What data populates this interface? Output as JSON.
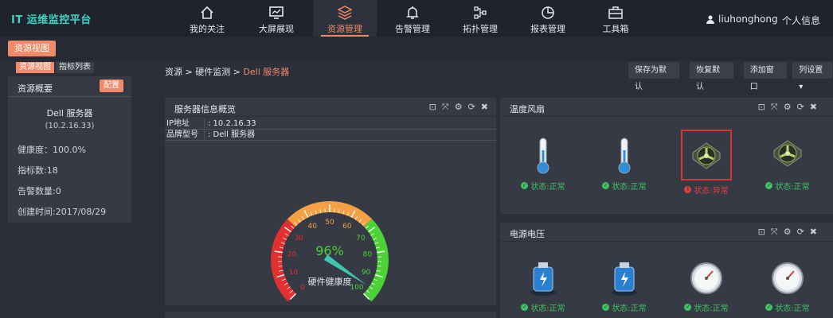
{
  "app": {
    "logo": "IT 运维监控平台"
  },
  "nav": [
    {
      "label": "我的关注",
      "icon": "home-icon"
    },
    {
      "label": "大屏展现",
      "icon": "monitor-icon"
    },
    {
      "label": "资源管理",
      "icon": "layers-icon",
      "active": true
    },
    {
      "label": "告警管理",
      "icon": "bell-icon"
    },
    {
      "label": "拓扑管理",
      "icon": "topology-icon"
    },
    {
      "label": "报表管理",
      "icon": "pie-chart-icon"
    },
    {
      "label": "工具箱",
      "icon": "toolbox-icon"
    }
  ],
  "user": {
    "name": "liuhonghong",
    "profile": "个人信息"
  },
  "subbar": {
    "main_tab": "资源视图"
  },
  "left": {
    "tabs": [
      "资源视图",
      "指标列表"
    ],
    "title": "资源概要",
    "config": "配置",
    "device_name": "Dell 服务器",
    "device_ip": "(10.2.16.33)",
    "rows": [
      "健康度：100.0%",
      "指标数:18",
      "告警数量:0",
      "创建时间:2017/08/29"
    ]
  },
  "breadcrumb": {
    "root": "资源",
    "sep1": " > ",
    "mid": "硬件监测",
    "sep2": " > ",
    "current": "Dell 服务器"
  },
  "toolbar": {
    "save_default": "保存为默认",
    "restore_default": "恢复默认",
    "add_window": "添加窗口",
    "column_settings": "列设置"
  },
  "panels": {
    "server_info": {
      "title": "服务器信息概览",
      "rows": [
        {
          "k": "IP地址",
          "v": ": 10.2.16.33"
        },
        {
          "k": "品牌型号",
          "v": ": Dell 服务器"
        }
      ],
      "gauge": {
        "value": 96,
        "display": "96%",
        "label": "硬件健康度",
        "ticks": [
          "0",
          "10",
          "20",
          "30",
          "40",
          "50",
          "60",
          "70",
          "80",
          "90",
          "100"
        ]
      }
    },
    "temp_fan": {
      "title": "温度风扇",
      "items": [
        {
          "icon": "thermometer-icon",
          "status": "状态:正常",
          "state": "ok"
        },
        {
          "icon": "thermometer-icon",
          "status": "状态:正常",
          "state": "ok"
        },
        {
          "icon": "fan-icon",
          "status": "状态:异常",
          "state": "bad"
        },
        {
          "icon": "fan-icon",
          "status": "状态:正常",
          "state": "ok"
        }
      ]
    },
    "power": {
      "title": "电源电压",
      "items": [
        {
          "icon": "battery-icon",
          "status": "状态:正常",
          "state": "ok"
        },
        {
          "icon": "battery-icon",
          "status": "状态:正常",
          "state": "ok"
        },
        {
          "icon": "voltmeter-icon",
          "status": "状态:正常",
          "state": "ok"
        },
        {
          "icon": "voltmeter-icon",
          "status": "状态:正常",
          "state": "ok"
        }
      ]
    }
  },
  "colors": {
    "accent": "#f08a6a",
    "ok": "#3ec35e",
    "bad": "#e04040",
    "gauge_green": "#4cd137",
    "gauge_orange": "#f5a042",
    "gauge_red": "#e03030"
  }
}
